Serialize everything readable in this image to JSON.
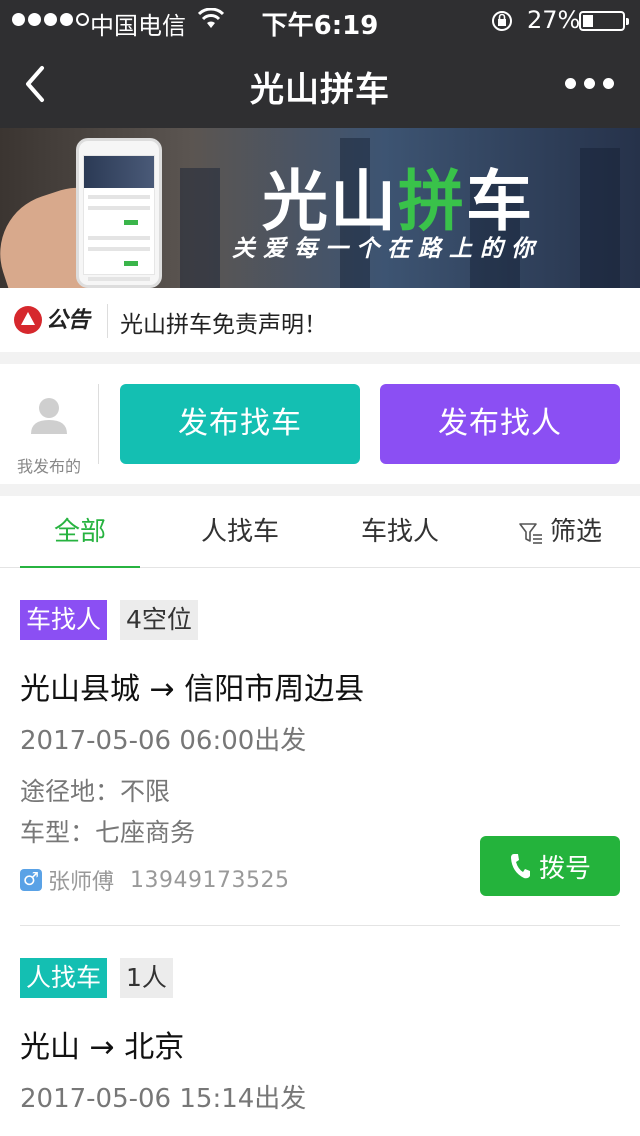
{
  "status_bar": {
    "carrier": "中国电信",
    "time": "下午6:19",
    "battery": "27%",
    "battery_level": 0.27
  },
  "nav": {
    "title": "光山拼车"
  },
  "banner": {
    "title_part1": "光山",
    "title_part2": "拼",
    "title_part3": "车",
    "slogan": "关爱每一个在路上的你"
  },
  "notice": {
    "label": "公告",
    "text": "光山拼车免责声明！"
  },
  "actions": {
    "mine_label": "我发布的",
    "find_car": "发布找车",
    "find_person": "发布找人"
  },
  "tabs": [
    {
      "label": "全部"
    },
    {
      "label": "人找车"
    },
    {
      "label": "车找人"
    },
    {
      "label": "筛选"
    }
  ],
  "listings": [
    {
      "type": "车找人",
      "seats": "4空位",
      "route": "光山县城 → 信阳市周边县",
      "departure": "2017-05-06 06:00出发",
      "via": "途径地：不限",
      "vehicle": "车型：七座商务",
      "driver": "张师傅",
      "phone": "13949173525",
      "call_label": "拨号"
    },
    {
      "type": "人找车",
      "seats": "1人",
      "route": "光山 → 北京",
      "departure": "2017-05-06 15:14出发"
    }
  ],
  "colors": {
    "header": "#2f2f31",
    "accent_green": "#27b340",
    "teal": "#14bfb2",
    "purple": "#8b4ff3"
  }
}
